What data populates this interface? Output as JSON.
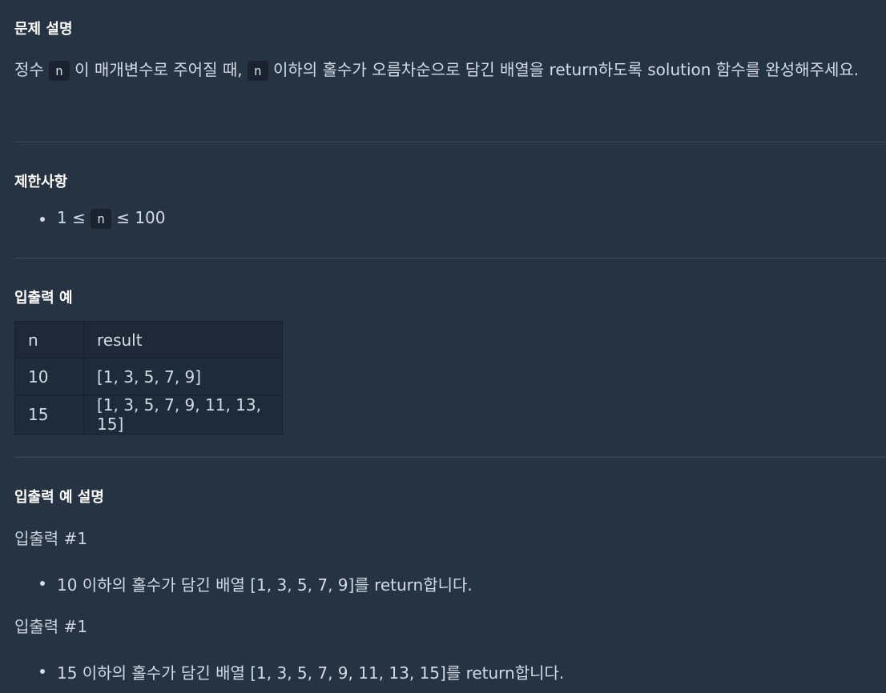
{
  "description": {
    "heading": "문제 설명",
    "text_part1": "정수 ",
    "code1": "n",
    "text_part2": " 이 매개변수로 주어질 때, ",
    "code2": "n",
    "text_part3": " 이하의 홀수가 오름차순으로 담긴 배열을 return하도록 solution 함수를 완성해주세요."
  },
  "constraints": {
    "heading": "제한사항",
    "items": [
      {
        "prefix": "1 ≤ ",
        "code": "n",
        "suffix": " ≤ 100"
      }
    ]
  },
  "io_example": {
    "heading": "입출력 예",
    "columns": [
      "n",
      "result"
    ],
    "rows": [
      [
        "10",
        "[1, 3, 5, 7, 9]"
      ],
      [
        "15",
        "[1, 3, 5, 7, 9, 11, 13, 15]"
      ]
    ]
  },
  "io_explanation": {
    "heading": "입출력 예 설명",
    "cases": [
      {
        "title": "입출력 #1",
        "bullet": "10 이하의 홀수가 담긴 배열 [1, 3, 5, 7, 9]를 return합니다."
      },
      {
        "title": "입출력 #1",
        "bullet": "15 이하의 홀수가 담긴 배열 [1, 3, 5, 7, 9, 11, 13, 15]를 return합니다."
      }
    ]
  }
}
